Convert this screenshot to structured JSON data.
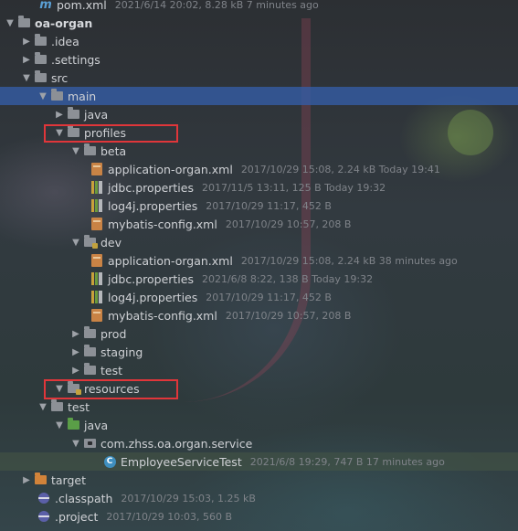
{
  "tree": {
    "rows": [
      {
        "name": "pom.xml",
        "meta": "2021/6/14 20:02, 8.28 kB 7 minutes ago",
        "icon": "maven-icon"
      },
      {
        "name": "oa-organ",
        "meta": "",
        "icon": "folder-icon"
      },
      {
        "name": ".idea",
        "meta": "",
        "icon": "folder-icon"
      },
      {
        "name": ".settings",
        "meta": "",
        "icon": "folder-icon"
      },
      {
        "name": "src",
        "meta": "",
        "icon": "folder-icon"
      },
      {
        "name": "main",
        "meta": "",
        "icon": "folder-icon"
      },
      {
        "name": "java",
        "meta": "",
        "icon": "folder-icon"
      },
      {
        "name": "profiles",
        "meta": "",
        "icon": "folder-icon"
      },
      {
        "name": "beta",
        "meta": "",
        "icon": "folder-icon"
      },
      {
        "name": "application-organ.xml",
        "meta": "2017/10/29 15:08, 2.24 kB Today 19:41",
        "icon": "xml-file-icon"
      },
      {
        "name": "jdbc.properties",
        "meta": "2017/11/5 13:11, 125 B Today 19:32",
        "icon": "properties-file-icon"
      },
      {
        "name": "log4j.properties",
        "meta": "2017/10/29 11:17, 452 B",
        "icon": "properties-file-icon"
      },
      {
        "name": "mybatis-config.xml",
        "meta": "2017/10/29 10:57, 208 B",
        "icon": "xml-file-icon"
      },
      {
        "name": "dev",
        "meta": "",
        "icon": "resources-folder-icon"
      },
      {
        "name": "application-organ.xml",
        "meta": "2017/10/29 15:08, 2.24 kB 38 minutes ago",
        "icon": "xml-file-icon"
      },
      {
        "name": "jdbc.properties",
        "meta": "2021/6/8 8:22, 138 B Today 19:32",
        "icon": "properties-file-icon"
      },
      {
        "name": "log4j.properties",
        "meta": "2017/10/29 11:17, 452 B",
        "icon": "properties-file-icon"
      },
      {
        "name": "mybatis-config.xml",
        "meta": "2017/10/29 10:57, 208 B",
        "icon": "xml-file-icon"
      },
      {
        "name": "prod",
        "meta": "",
        "icon": "folder-icon"
      },
      {
        "name": "staging",
        "meta": "",
        "icon": "folder-icon"
      },
      {
        "name": "test",
        "meta": "",
        "icon": "folder-icon"
      },
      {
        "name": "resources",
        "meta": "",
        "icon": "resources-folder-icon"
      },
      {
        "name": "test",
        "meta": "",
        "icon": "folder-icon"
      },
      {
        "name": "java",
        "meta": "",
        "icon": "test-folder-icon"
      },
      {
        "name": "com.zhss.oa.organ.service",
        "meta": "",
        "icon": "package-icon"
      },
      {
        "name": "EmployeeServiceTest",
        "meta": "2021/6/8 19:29, 747 B 17 minutes ago",
        "icon": "java-class-icon"
      },
      {
        "name": "target",
        "meta": "",
        "icon": "excluded-folder-icon"
      },
      {
        "name": ".classpath",
        "meta": "2017/10/29 15:03, 1.25 kB",
        "icon": "eclipse-file-icon"
      },
      {
        "name": ".project",
        "meta": "2017/10/29 10:03, 560 B",
        "icon": "eclipse-file-icon"
      }
    ]
  },
  "colors": {
    "selection": "#345ca5",
    "highlight_box": "#e0363a",
    "test_folder": "#5a9e47",
    "excluded_folder": "#d2833a",
    "java_class": "#3f8fbf"
  }
}
